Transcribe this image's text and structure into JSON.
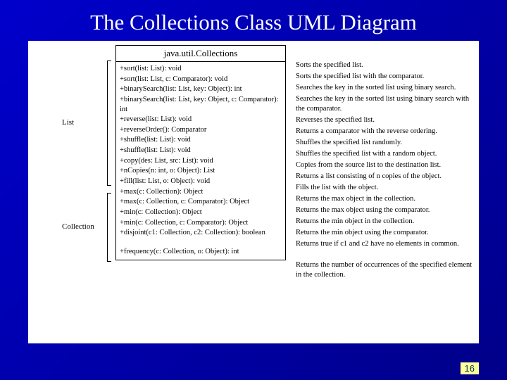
{
  "title": "The Collections Class UML Diagram",
  "class_name": "java.util.Collections",
  "side_labels": {
    "list": "List",
    "collection": "Collection"
  },
  "methods": [
    {
      "sig": "+sort(list: List): void",
      "desc": "Sorts the specified list."
    },
    {
      "sig": "+sort(list: List, c: Comparator): void",
      "desc": "Sorts the specified list with the comparator."
    },
    {
      "sig": "+binarySearch(list: List, key: Object): int",
      "desc": "Searches the key in the sorted list using binary search."
    },
    {
      "sig": "+binarySearch(list: List, key: Object, c: Comparator): int",
      "desc": "Searches the key in the sorted list using binary search with the comparator."
    },
    {
      "sig": "+reverse(list: List): void",
      "desc": "Reverses the specified list."
    },
    {
      "sig": "+reverseOrder(): Comparator",
      "desc": "Returns a comparator with the reverse ordering."
    },
    {
      "sig": "+shuffle(list: List): void",
      "desc": "Shuffles the specified list randomly."
    },
    {
      "sig": "+shuffle(list: List): void",
      "desc": "Shuffles the specified list with a random object."
    },
    {
      "sig": "+copy(des: List, src: List): void",
      "desc": "Copies from the source list to the destination list."
    },
    {
      "sig": "+nCopies(n: int, o: Object): List",
      "desc": "Returns a list consisting of n copies of the object."
    },
    {
      "sig": "+fill(list: List, o: Object): void",
      "desc": "Fills the list with the object."
    },
    {
      "sig": "+max(c: Collection): Object",
      "desc": "Returns the max object in the collection."
    },
    {
      "sig": "+max(c: Collection, c: Comparator): Object",
      "desc": "Returns the max object using the comparator."
    },
    {
      "sig": "+min(c: Collection): Object",
      "desc": "Returns the min object in the collection."
    },
    {
      "sig": "+min(c: Collection, c: Comparator): Object",
      "desc": "Returns the min object using the comparator."
    },
    {
      "sig": "+disjoint(c1: Collection, c2: Collection): boolean",
      "desc": "Returns true if c1 and c2 have no elements in common."
    },
    {
      "sig": "+frequency(c: Collection, o: Object): int",
      "desc": "Returns the number of occurrences of the specified element in the collection."
    }
  ],
  "page_number": "16"
}
